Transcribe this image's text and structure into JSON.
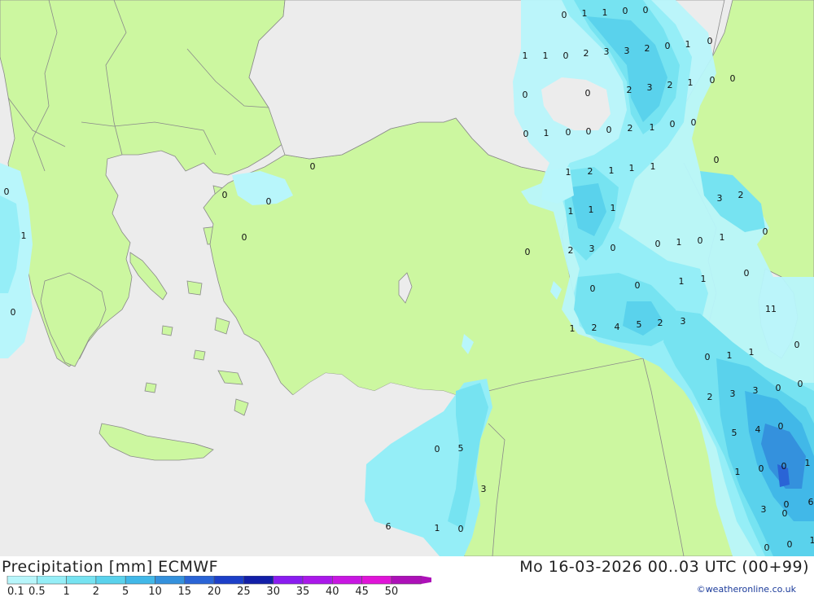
{
  "header": {
    "product": "Precipitation [mm] ECMWF",
    "valid": "Mo 16-03-2026 00..03 UTC (00+99)",
    "credit": "©weatheronline.co.uk"
  },
  "colors": {
    "sea": "#ececec",
    "land": "#ccf7a0",
    "border": "#8a8a8a"
  },
  "legend": {
    "labels": [
      "0.1",
      "0.5",
      "1",
      "2",
      "5",
      "10",
      "15",
      "20",
      "25",
      "30",
      "35",
      "40",
      "45",
      "50"
    ],
    "colors": [
      "#b8f6fb",
      "#95eef7",
      "#76e3f1",
      "#5ad2ec",
      "#41b8e8",
      "#3491dd",
      "#2a64d6",
      "#1c3fc8",
      "#121fa8",
      "#8a1cf0",
      "#aa18ea",
      "#c816e2",
      "#e014d8",
      "#ad10b8"
    ]
  },
  "precip_values": [
    {
      "v": "0"
    },
    {
      "v": "1"
    },
    {
      "v": "1"
    },
    {
      "v": "0"
    },
    {
      "v": "0"
    },
    {
      "v": "1"
    },
    {
      "v": "1"
    },
    {
      "v": "0"
    },
    {
      "v": "2"
    },
    {
      "v": "3"
    },
    {
      "v": "3"
    },
    {
      "v": "2"
    },
    {
      "v": "0"
    },
    {
      "v": "1"
    },
    {
      "v": "0"
    },
    {
      "v": "0"
    },
    {
      "v": "0"
    },
    {
      "v": "2"
    },
    {
      "v": "3"
    },
    {
      "v": "2"
    },
    {
      "v": "1"
    },
    {
      "v": "0"
    },
    {
      "v": "0"
    },
    {
      "v": "0"
    },
    {
      "v": "1"
    },
    {
      "v": "0"
    },
    {
      "v": "0"
    },
    {
      "v": "0"
    },
    {
      "v": "2"
    },
    {
      "v": "1"
    },
    {
      "v": "0"
    },
    {
      "v": "0"
    },
    {
      "v": "0"
    },
    {
      "v": "0"
    },
    {
      "v": "0"
    },
    {
      "v": "0"
    },
    {
      "v": "0"
    },
    {
      "v": "1"
    },
    {
      "v": "0"
    },
    {
      "v": "0"
    },
    {
      "v": "1"
    },
    {
      "v": "2"
    },
    {
      "v": "1"
    },
    {
      "v": "1"
    },
    {
      "v": "1"
    },
    {
      "v": "1"
    },
    {
      "v": "3"
    },
    {
      "v": "2"
    },
    {
      "v": "1"
    },
    {
      "v": "1"
    },
    {
      "v": "0"
    },
    {
      "v": "0"
    },
    {
      "v": "0"
    },
    {
      "v": "2"
    },
    {
      "v": "3"
    },
    {
      "v": "0"
    },
    {
      "v": "0"
    },
    {
      "v": "1"
    },
    {
      "v": "0"
    },
    {
      "v": "1"
    },
    {
      "v": "0"
    },
    {
      "v": "0"
    },
    {
      "v": "1"
    },
    {
      "v": "1"
    },
    {
      "v": "0"
    },
    {
      "v": "11"
    },
    {
      "v": "1"
    },
    {
      "v": "2"
    },
    {
      "v": "4"
    },
    {
      "v": "5"
    },
    {
      "v": "2"
    },
    {
      "v": "3"
    },
    {
      "v": "0"
    },
    {
      "v": "1"
    },
    {
      "v": "1"
    },
    {
      "v": "2"
    },
    {
      "v": "0"
    },
    {
      "v": "3"
    },
    {
      "v": "3"
    },
    {
      "v": "5"
    },
    {
      "v": "0"
    },
    {
      "v": "4"
    },
    {
      "v": "0"
    },
    {
      "v": "0"
    },
    {
      "v": "5"
    },
    {
      "v": "1"
    },
    {
      "v": "0"
    },
    {
      "v": "0"
    },
    {
      "v": "1"
    },
    {
      "v": "3"
    },
    {
      "v": "6"
    },
    {
      "v": "3"
    },
    {
      "v": "0"
    },
    {
      "v": "0"
    },
    {
      "v": "6"
    },
    {
      "v": "1"
    },
    {
      "v": "0"
    },
    {
      "v": "0"
    },
    {
      "v": "0"
    },
    {
      "v": "1"
    },
    {
      "v": "0"
    },
    {
      "v": "2"
    },
    {
      "v": "2"
    }
  ]
}
